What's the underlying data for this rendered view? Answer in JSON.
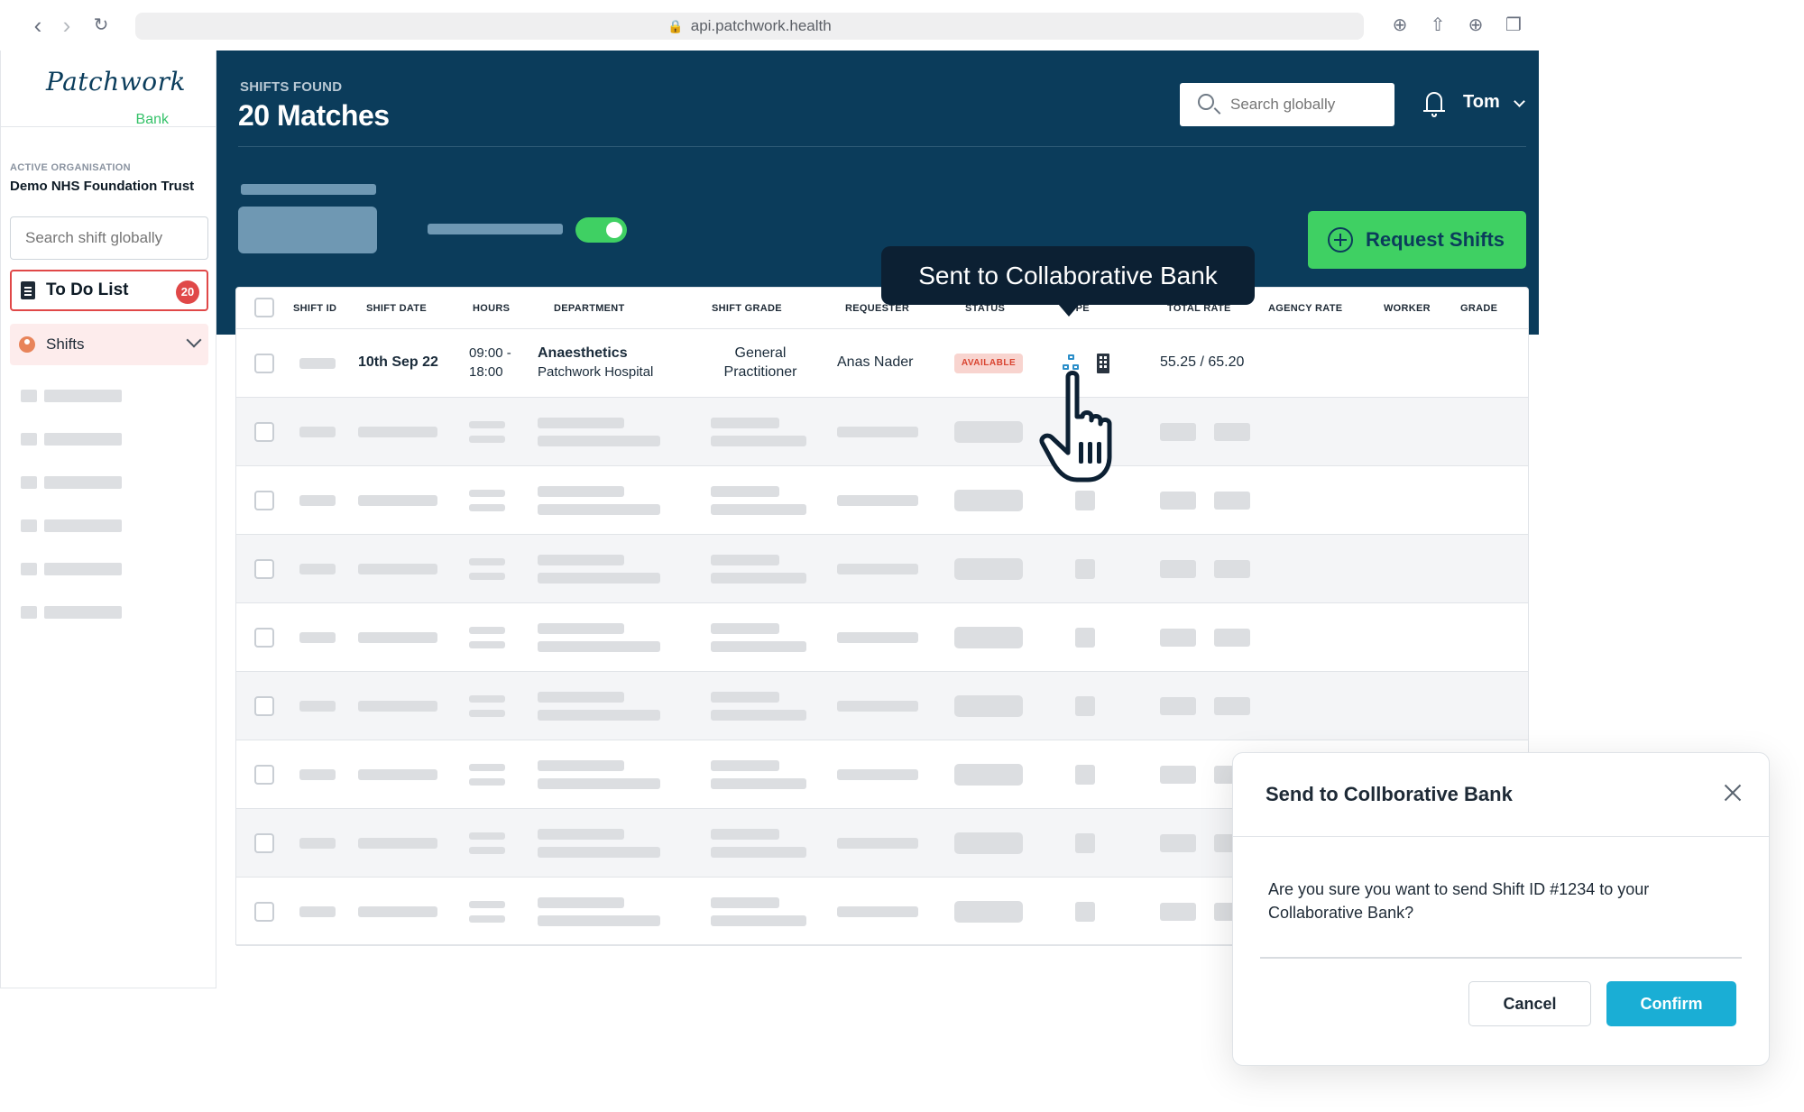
{
  "browser": {
    "url": "api.patchwork.health"
  },
  "sidebar": {
    "logo_main": "Patchwork",
    "logo_sub": "Bank",
    "org_label": "ACTIVE ORGANISATION",
    "org_name": "Demo NHS Foundation Trust",
    "search_placeholder": "Search shift globally",
    "todo_label": "To Do List",
    "todo_count": "20",
    "shifts_label": "Shifts"
  },
  "header": {
    "label": "SHIFTS FOUND",
    "title": "20 Matches",
    "search_placeholder": "Search globally",
    "user_name": "Tom",
    "request_label": "Request Shifts"
  },
  "table": {
    "columns": [
      "SHIFT ID",
      "SHIFT DATE",
      "HOURS",
      "DEPARTMENT",
      "SHIFT GRADE",
      "REQUESTER",
      "STATUS",
      "TYPE",
      "TOTAL RATE",
      "AGENCY RATE",
      "WORKER",
      "GRADE"
    ],
    "first_row": {
      "date": "10th Sep 22",
      "hours_start": "09:00 -",
      "hours_end": "18:00",
      "department": "Anaesthetics",
      "hospital": "Patchwork Hospital",
      "grade_line1": "General",
      "grade_line2": "Practitioner",
      "requester": "Anas Nader",
      "status": "AVAILABLE",
      "total_rate": "55.25 / 65.20"
    }
  },
  "tooltip": {
    "text": "Sent to Collaborative Bank"
  },
  "modal": {
    "title": "Send to Collborative Bank",
    "body": "Are you sure you want to send Shift ID #1234 to your Collaborative Bank?",
    "cancel_label": "Cancel",
    "confirm_label": "Confirm"
  },
  "colors": {
    "brand_navy": "#0b3c5b",
    "accent_green": "#3fd063",
    "confirm_blue": "#1aaed5",
    "alert_red": "#e04848"
  }
}
